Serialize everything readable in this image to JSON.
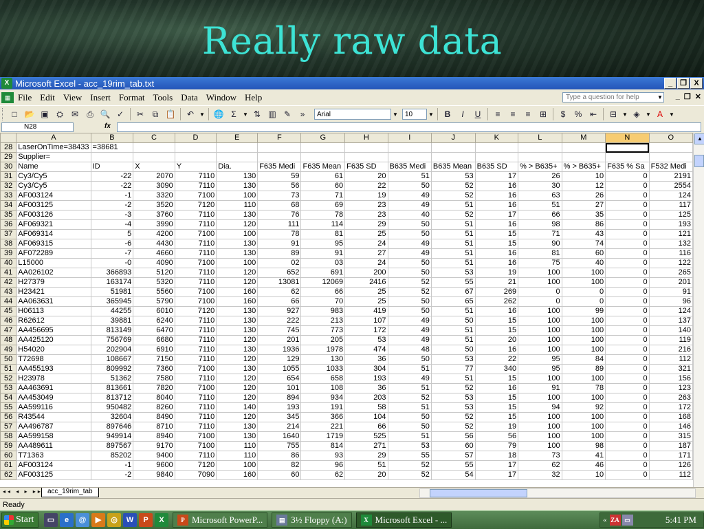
{
  "slide": {
    "title": "Really raw data"
  },
  "window": {
    "title": "Microsoft Excel - acc_19rim_tab.txt",
    "min": "_",
    "restore": "❐",
    "close": "X"
  },
  "menu": {
    "items": [
      "File",
      "Edit",
      "View",
      "Insert",
      "Format",
      "Tools",
      "Data",
      "Window",
      "Help"
    ],
    "help_placeholder": "Type a question for help"
  },
  "toolbar": {
    "font": "Arial",
    "size": "10"
  },
  "formula": {
    "cell": "N28",
    "fx": "fx",
    "value": ""
  },
  "columns": [
    "A",
    "B",
    "C",
    "D",
    "E",
    "F",
    "G",
    "H",
    "I",
    "J",
    "K",
    "L",
    "M",
    "N",
    "O"
  ],
  "rows": [
    {
      "n": "28",
      "c": [
        "LaserOnTime=38433",
        "=38681",
        "",
        "",
        "",
        "",
        "",
        "",
        "",
        "",
        "",
        "",
        "",
        "",
        ""
      ]
    },
    {
      "n": "29",
      "c": [
        "Supplier=",
        "",
        "",
        "",
        "",
        "",
        "",
        "",
        "",
        "",
        "",
        "",
        "",
        "",
        ""
      ]
    },
    {
      "n": "30",
      "c": [
        "Name",
        "ID",
        "X",
        "Y",
        "Dia.",
        "F635 Medi",
        "F635 Mean",
        "F635 SD",
        "B635 Medi",
        "B635 Mean",
        "B635 SD",
        "% > B635+",
        "% > B635+",
        "F635 % Sa",
        "F532 Medi"
      ]
    },
    {
      "n": "31",
      "c": [
        "Cy3/Cy5",
        "-22",
        "2070",
        "7110",
        "130",
        "59",
        "61",
        "20",
        "51",
        "53",
        "17",
        "26",
        "10",
        "0",
        "2191"
      ]
    },
    {
      "n": "32",
      "c": [
        "Cy3/Cy5",
        "-22",
        "3090",
        "7110",
        "130",
        "56",
        "60",
        "22",
        "50",
        "52",
        "16",
        "30",
        "12",
        "0",
        "2554"
      ]
    },
    {
      "n": "33",
      "c": [
        "AF003124",
        "-1",
        "3320",
        "7100",
        "100",
        "73",
        "71",
        "19",
        "49",
        "52",
        "16",
        "63",
        "26",
        "0",
        "124"
      ]
    },
    {
      "n": "34",
      "c": [
        "AF003125",
        "-2",
        "3520",
        "7120",
        "110",
        "68",
        "69",
        "23",
        "49",
        "51",
        "16",
        "51",
        "27",
        "0",
        "117"
      ]
    },
    {
      "n": "35",
      "c": [
        "AF003126",
        "-3",
        "3760",
        "7110",
        "130",
        "76",
        "78",
        "23",
        "40",
        "52",
        "17",
        "66",
        "35",
        "0",
        "125"
      ]
    },
    {
      "n": "36",
      "c": [
        "AF069321",
        "-4",
        "3990",
        "7110",
        "120",
        "111",
        "114",
        "29",
        "50",
        "51",
        "16",
        "98",
        "86",
        "0",
        "193"
      ]
    },
    {
      "n": "37",
      "c": [
        "AF069314",
        "5",
        "4200",
        "7100",
        "100",
        "78",
        "81",
        "25",
        "50",
        "51",
        "15",
        "71",
        "43",
        "0",
        "121"
      ]
    },
    {
      "n": "38",
      "c": [
        "AF069315",
        "-6",
        "4430",
        "7110",
        "130",
        "91",
        "95",
        "24",
        "49",
        "51",
        "15",
        "90",
        "74",
        "0",
        "132"
      ]
    },
    {
      "n": "39",
      "c": [
        "AF072289",
        "-7",
        "4660",
        "7110",
        "130",
        "89",
        "91",
        "27",
        "49",
        "51",
        "16",
        "81",
        "60",
        "0",
        "116"
      ]
    },
    {
      "n": "40",
      "c": [
        "L15000",
        "-0",
        "4090",
        "7100",
        "100",
        "02",
        "03",
        "24",
        "50",
        "51",
        "16",
        "75",
        "40",
        "0",
        "122"
      ]
    },
    {
      "n": "41",
      "c": [
        "AA026102",
        "366893",
        "5120",
        "7110",
        "120",
        "652",
        "691",
        "200",
        "50",
        "53",
        "19",
        "100",
        "100",
        "0",
        "265"
      ]
    },
    {
      "n": "42",
      "c": [
        "H27379",
        "163174",
        "5320",
        "7110",
        "120",
        "13081",
        "12069",
        "2416",
        "52",
        "55",
        "21",
        "100",
        "100",
        "0",
        "201"
      ]
    },
    {
      "n": "43",
      "c": [
        "H23421",
        "51981",
        "5560",
        "7100",
        "160",
        "62",
        "66",
        "25",
        "52",
        "67",
        "269",
        "0",
        "0",
        "0",
        "91"
      ]
    },
    {
      "n": "44",
      "c": [
        "AA063631",
        "365945",
        "5790",
        "7100",
        "160",
        "66",
        "70",
        "25",
        "50",
        "65",
        "262",
        "0",
        "0",
        "0",
        "96"
      ]
    },
    {
      "n": "45",
      "c": [
        "H06113",
        "44255",
        "6010",
        "7120",
        "130",
        "927",
        "983",
        "419",
        "50",
        "51",
        "16",
        "100",
        "99",
        "0",
        "124"
      ]
    },
    {
      "n": "46",
      "c": [
        "R62612",
        "39881",
        "6240",
        "7110",
        "130",
        "222",
        "213",
        "107",
        "49",
        "50",
        "15",
        "100",
        "100",
        "0",
        "137"
      ]
    },
    {
      "n": "47",
      "c": [
        "AA456695",
        "813149",
        "6470",
        "7110",
        "130",
        "745",
        "773",
        "172",
        "49",
        "51",
        "15",
        "100",
        "100",
        "0",
        "140"
      ]
    },
    {
      "n": "48",
      "c": [
        "AA425120",
        "756769",
        "6680",
        "7110",
        "120",
        "201",
        "205",
        "53",
        "49",
        "51",
        "20",
        "100",
        "100",
        "0",
        "119"
      ]
    },
    {
      "n": "49",
      "c": [
        "H54020",
        "202904",
        "6910",
        "7110",
        "130",
        "1936",
        "1978",
        "474",
        "48",
        "50",
        "16",
        "100",
        "100",
        "0",
        "216"
      ]
    },
    {
      "n": "50",
      "c": [
        "T72698",
        "108667",
        "7150",
        "7110",
        "120",
        "129",
        "130",
        "36",
        "50",
        "53",
        "22",
        "95",
        "84",
        "0",
        "112"
      ]
    },
    {
      "n": "51",
      "c": [
        "AA455193",
        "809992",
        "7360",
        "7100",
        "130",
        "1055",
        "1033",
        "304",
        "51",
        "77",
        "340",
        "95",
        "89",
        "0",
        "321"
      ]
    },
    {
      "n": "52",
      "c": [
        "H23978",
        "51362",
        "7580",
        "7110",
        "120",
        "654",
        "658",
        "193",
        "49",
        "51",
        "15",
        "100",
        "100",
        "0",
        "156"
      ]
    },
    {
      "n": "53",
      "c": [
        "AA463691",
        "813661",
        "7820",
        "7100",
        "120",
        "101",
        "108",
        "36",
        "51",
        "52",
        "16",
        "91",
        "78",
        "0",
        "123"
      ]
    },
    {
      "n": "54",
      "c": [
        "AA453049",
        "813712",
        "8040",
        "7110",
        "120",
        "894",
        "934",
        "203",
        "52",
        "53",
        "15",
        "100",
        "100",
        "0",
        "263"
      ]
    },
    {
      "n": "55",
      "c": [
        "AA599116",
        "950482",
        "8260",
        "7110",
        "140",
        "193",
        "191",
        "58",
        "51",
        "53",
        "15",
        "94",
        "92",
        "0",
        "172"
      ]
    },
    {
      "n": "56",
      "c": [
        "R43544",
        "32604",
        "8490",
        "7110",
        "120",
        "345",
        "366",
        "104",
        "50",
        "52",
        "15",
        "100",
        "100",
        "0",
        "168"
      ]
    },
    {
      "n": "57",
      "c": [
        "AA496787",
        "897646",
        "8710",
        "7110",
        "130",
        "214",
        "221",
        "66",
        "50",
        "52",
        "19",
        "100",
        "100",
        "0",
        "146"
      ]
    },
    {
      "n": "58",
      "c": [
        "AA599158",
        "949914",
        "8940",
        "7100",
        "130",
        "1640",
        "1719",
        "525",
        "51",
        "56",
        "56",
        "100",
        "100",
        "0",
        "315"
      ]
    },
    {
      "n": "59",
      "c": [
        "AA489611",
        "897567",
        "9170",
        "7100",
        "110",
        "755",
        "814",
        "271",
        "53",
        "60",
        "79",
        "100",
        "98",
        "0",
        "187"
      ]
    },
    {
      "n": "60",
      "c": [
        "T71363",
        "85202",
        "9400",
        "7110",
        "110",
        "86",
        "93",
        "29",
        "55",
        "57",
        "18",
        "73",
        "41",
        "0",
        "171"
      ]
    },
    {
      "n": "61",
      "c": [
        "AF003124",
        "-1",
        "9600",
        "7120",
        "100",
        "82",
        "96",
        "51",
        "52",
        "55",
        "17",
        "62",
        "46",
        "0",
        "126"
      ]
    },
    {
      "n": "62",
      "c": [
        "AF003125",
        "-2",
        "9840",
        "7090",
        "160",
        "60",
        "62",
        "20",
        "52",
        "54",
        "17",
        "32",
        "10",
        "0",
        "112"
      ]
    }
  ],
  "sheet": {
    "tab": "acc_19rim_tab",
    "status": "Ready"
  },
  "taskbar": {
    "start": "Start",
    "tasks": [
      "Microsoft PowerP...",
      "3½ Floppy (A:)",
      "Microsoft Excel - ..."
    ],
    "clock": "5:41 PM",
    "chevron": "«"
  },
  "colors": {
    "title": "#3de3d5",
    "titlebar": "#2455b8",
    "taskbar": "#3f6b3c"
  }
}
